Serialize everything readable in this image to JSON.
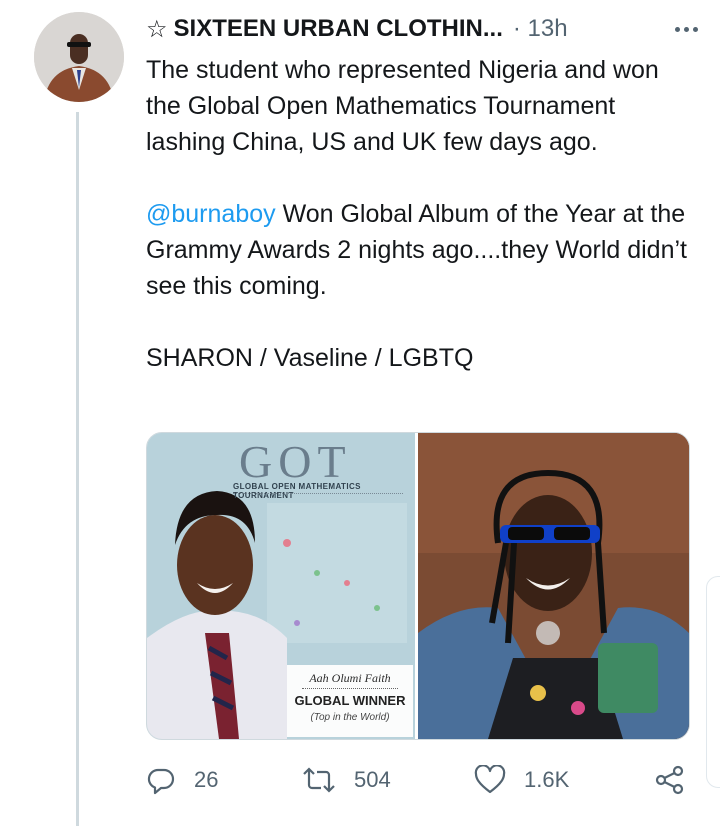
{
  "tweet": {
    "author_name": "SIXTEEN URBAN CLOTHIN...",
    "time": "13h",
    "time_separator": "·",
    "paragraph1": "The student who represented Nigeria and won the Global Open Mathematics Tournament lashing China, US and UK few days ago.",
    "mention": "@burnaboy",
    "paragraph2_rest": " Won Global Album of the Year at the Grammy Awards 2 nights ago....they World didn’t see this coming.",
    "paragraph3": "SHARON / Vaseline / LGBTQ"
  },
  "media": {
    "left_image": {
      "logo_text": "GOT",
      "title": "GLOBAL OPEN MATHEMATICS TOURNAMENT",
      "signature": "Aah Olumi Faith",
      "winner_label": "GLOBAL WINNER",
      "winner_sub": "(Top in the World)"
    }
  },
  "actions": {
    "reply_count": "26",
    "retweet_count": "504",
    "like_count": "1.6K"
  },
  "icons": {
    "star": "star-icon",
    "more": "more-horizontal-icon",
    "reply": "reply-icon",
    "retweet": "retweet-icon",
    "like": "heart-icon",
    "share": "share-icon"
  },
  "colors": {
    "mention": "#1d9bf0",
    "secondary_text": "#536471",
    "thread_line": "#cfd9de"
  }
}
